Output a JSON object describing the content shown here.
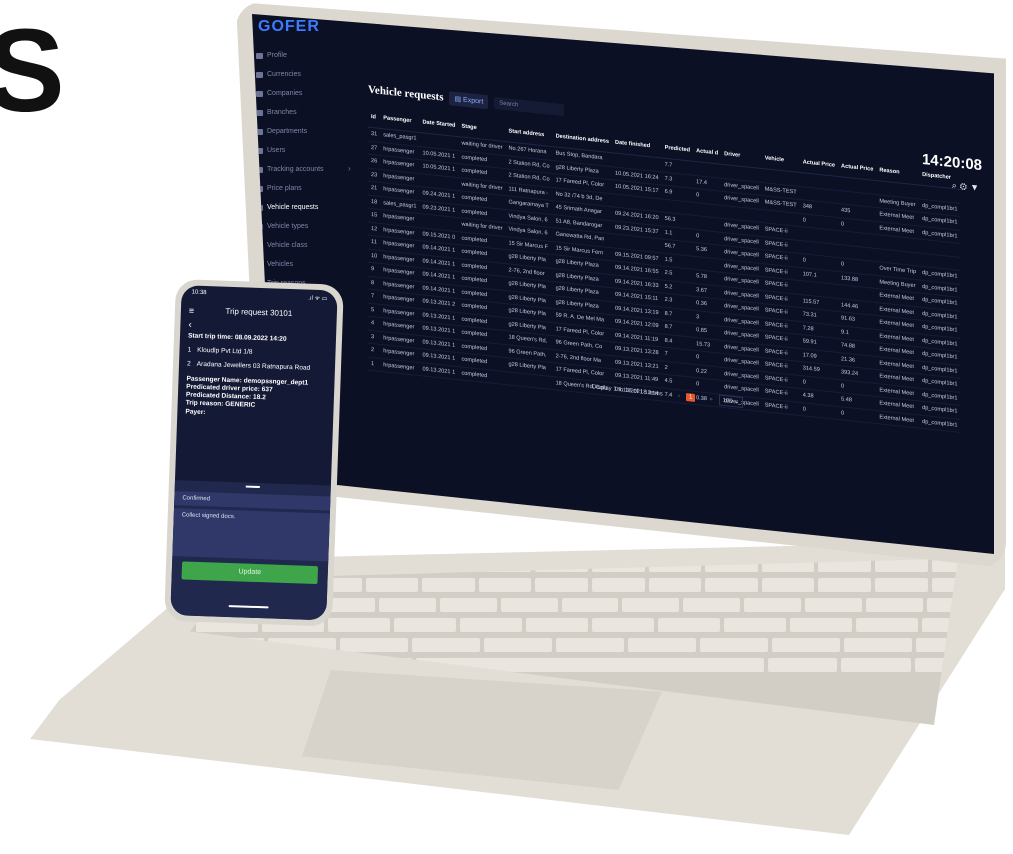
{
  "hero": {
    "letter": "S"
  },
  "laptop": {
    "logo": "GOFER",
    "sidebar": [
      {
        "label": "Profile",
        "icon": "profile-icon",
        "active": false
      },
      {
        "label": "Currencies",
        "icon": "currency-icon",
        "active": false
      },
      {
        "label": "Companies",
        "icon": "company-icon",
        "active": false
      },
      {
        "label": "Branches",
        "icon": "branch-icon",
        "active": false
      },
      {
        "label": "Departments",
        "icon": "department-icon",
        "active": false
      },
      {
        "label": "Users",
        "icon": "users-icon",
        "active": false
      },
      {
        "label": "Tracking accounts",
        "icon": "tracking-icon",
        "active": false
      },
      {
        "label": "Price plans",
        "icon": "price-icon",
        "active": false
      },
      {
        "label": "Vehicle requests",
        "icon": "request-icon",
        "active": true
      },
      {
        "label": "Vehicle types",
        "icon": "vehicle-type-icon",
        "active": false
      },
      {
        "label": "Vehicle class",
        "icon": "vehicle-class-icon",
        "active": false
      },
      {
        "label": "Vehicles",
        "icon": "vehicle-icon",
        "active": false
      },
      {
        "label": "Trip reasons",
        "icon": "reason-icon",
        "active": false
      }
    ],
    "page_title": "Vehicle requests",
    "export_label": "Export",
    "search_placeholder": "Search",
    "clock": "14:20:08",
    "table": {
      "headers": [
        "Id",
        "Passenger",
        "Date Started",
        "Stage",
        "Start address",
        "Destination address",
        "Date finished",
        "Predicted",
        "Actual d",
        "Driver",
        "Vehicle",
        "Actual Price",
        "Actual Price",
        "Reason",
        "Dispatcher"
      ],
      "rows": [
        [
          "31",
          "sales_pasgr1",
          "",
          "waiting for driver",
          "No.267 Horana",
          "Bus Stop, Bandara",
          "",
          "7.7",
          "",
          "",
          "",
          "",
          "",
          "",
          ""
        ],
        [
          "27",
          "hrpassenger",
          "10.05.2021 1",
          "completed",
          "2 Station Rd, Co",
          "g28 Liberty Plaza",
          "10.05.2021 16:24",
          "7.3",
          "17.4",
          "driver_spacell",
          "M&SS-TEST",
          "",
          "",
          "Meeting Buyer",
          "dp_compl1br1"
        ],
        [
          "26",
          "hrpassenger",
          "10.05.2021 1",
          "completed",
          "2 Station Rd, Co",
          "17 Fareed Pl, Color",
          "10.05.2021 15:17",
          "6.9",
          "0",
          "driver_spacell",
          "M&SS-TEST",
          "348",
          "435",
          "External Meet",
          "dp_compl1br1"
        ],
        [
          "23",
          "hrpassenger",
          "",
          "waiting for driver",
          "111 Ratnapura -",
          "No 32 /74 b 3d, De",
          "",
          "",
          "",
          "",
          "",
          "0",
          "0",
          "External Meet",
          "dp_compl1br1"
        ],
        [
          "21",
          "hrpassenger",
          "09.24.2021 1",
          "completed",
          "Gangaramaya T",
          "45 Srimath Anagar",
          "09.24.2021 16:20",
          "56.3",
          "",
          "driver_spacell",
          "SPACE-ii",
          "",
          "",
          "",
          ""
        ],
        [
          "18",
          "sales_pasgr1",
          "09.23.2021 1",
          "completed",
          "Vindya Salon, 6",
          "51 A8, Bandarogar",
          "09.23.2021 15:37",
          "1.1",
          "0",
          "driver_spacell",
          "SPACE-ii",
          "",
          "",
          "",
          ""
        ],
        [
          "15",
          "hrpassenger",
          "",
          "waiting for driver",
          "Vindya Salon, 6",
          "Ganewatta Rd, Pan",
          "",
          "56.7",
          "5.36",
          "driver_spacell",
          "SPACE-ii",
          "0",
          "0",
          "Over Time Trip",
          "dp_compl1br1"
        ],
        [
          "12",
          "hrpassenger",
          "09.15.2021 0",
          "completed",
          "15 Sir Marcus F",
          "15 Sir Marcus Fern",
          "09.15.2021 09:57",
          "1.5",
          "",
          "driver_spacell",
          "SPACE-ii",
          "107.1",
          "133.88",
          "Meeting Buyer",
          "dp_compl1br1"
        ],
        [
          "11",
          "hrpassenger",
          "09.14.2021 1",
          "completed",
          "g28 Liberty Pla",
          "g28 Liberty Plaza",
          "09.14.2021 16:55",
          "2.5",
          "5.78",
          "driver_spacell",
          "SPACE-ii",
          "",
          "",
          "External Meet",
          "dp_compl1br1"
        ],
        [
          "10",
          "hrpassenger",
          "09.14.2021 1",
          "completed",
          "2-76, 2nd floor",
          "g28 Liberty Plaza",
          "09.14.2021 16:33",
          "5.2",
          "3.67",
          "driver_spacell",
          "SPACE-ii",
          "115.57",
          "144.46",
          "External Meet",
          "dp_compl1br1"
        ],
        [
          "9",
          "hrpassenger",
          "09.14.2021 1",
          "completed",
          "g28 Liberty Pla",
          "g28 Liberty Plaza",
          "09.14.2021 15:11",
          "2.3",
          "0.36",
          "driver_spacell",
          "SPACE-ii",
          "73.31",
          "91.63",
          "External Meet",
          "dp_compl1br1"
        ],
        [
          "8",
          "hrpassenger",
          "09.14.2021 1",
          "completed",
          "g28 Liberty Pla",
          "g28 Liberty Plaza",
          "09.14.2021 13:19",
          "8.7",
          "3",
          "driver_spacell",
          "SPACE-ii",
          "7.28",
          "9.1",
          "External Meet",
          "dp_compl1br1"
        ],
        [
          "7",
          "hrpassenger",
          "09.13.2021 2",
          "completed",
          "g28 Liberty Pla",
          "59 R. A. De Mel Ma",
          "09.14.2021 12:09",
          "8.7",
          "0.85",
          "driver_spacell",
          "SPACE-ii",
          "59.91",
          "74.88",
          "External Meet",
          "dp_compl1br1"
        ],
        [
          "5",
          "hrpassenger",
          "09.13.2021 1",
          "completed",
          "g28 Liberty Pla",
          "17 Fareed Pl, Color",
          "09.14.2021 11:19",
          "8.4",
          "15.73",
          "driver_spacell",
          "SPACE-ii",
          "17.09",
          "21.36",
          "External Meet",
          "dp_compl1br1"
        ],
        [
          "4",
          "hrpassenger",
          "09.13.2021 1",
          "completed",
          "18 Queen's Rd,",
          "96 Green Path, Co",
          "09.13.2021 13:28",
          "7",
          "0",
          "driver_spacell",
          "SPACE-ii",
          "314.59",
          "393.24",
          "External Meet",
          "dp_compl1br1"
        ],
        [
          "3",
          "hrpassenger",
          "09.13.2021 1",
          "completed",
          "96 Green Path,",
          "2-76, 2nd floor Ma",
          "09.13.2021 13:21",
          "2",
          "0.22",
          "driver_spacell",
          "SPACE-ii",
          "0",
          "0",
          "External Meet",
          "dp_compl1br1"
        ],
        [
          "2",
          "hrpassenger",
          "09.13.2021 1",
          "completed",
          "g28 Liberty Pla",
          "17 Fareed Pl, Color",
          "09.13.2021 11:49",
          "4.5",
          "0",
          "driver_spacell",
          "SPACE-ii",
          "4.38",
          "5.48",
          "External Meet",
          "dp_compl1br1"
        ],
        [
          "1",
          "hrpassenger",
          "09.13.2021 1",
          "completed",
          "",
          "18 Queen's Rd, Colo",
          "09.13.2021 13:14",
          "7.4",
          "0.38",
          "driver_spacell",
          "SPACE-ii",
          "0",
          "0",
          "External Meet",
          "dp_compl1br1"
        ]
      ]
    },
    "pager": {
      "display": "Display 1 to 18 of 18 items",
      "first": "«",
      "prev": "‹",
      "current": "1",
      "next": "›",
      "last": "»",
      "page_size": "100"
    }
  },
  "phone": {
    "time": "10:38",
    "status_icons": ".ıl ᯤ ▭",
    "title": "Trip request 30101",
    "start_time": "Start trip time: 08.09.2022 14:20",
    "stops": [
      {
        "num": "1",
        "text": "Kloudlp Pvt Ltd 1/8"
      },
      {
        "num": "2",
        "text": "Aradana Jewellers 03 Ratnapura Road"
      }
    ],
    "details": [
      "Passenger Name: demopssnger_dept1",
      "Predicated driver price: 637",
      "Predicated Distance: 18.2",
      "Trip reason: GENERIC",
      "Payer:"
    ],
    "status_field": "Confirmed",
    "notes_field": "Collect signed docs.",
    "update_label": "Update"
  }
}
